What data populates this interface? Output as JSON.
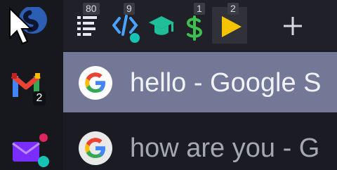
{
  "rail": {
    "apps": [
      {
        "name": "slack-app",
        "badge": ""
      },
      {
        "name": "gmail-app",
        "badge": "2"
      },
      {
        "name": "teams-app",
        "badge": ""
      }
    ]
  },
  "toolbar": {
    "tools": [
      {
        "name": "list-icon",
        "count": "80"
      },
      {
        "name": "code-icon",
        "count": "9"
      },
      {
        "name": "graduation-cap-icon",
        "count": ""
      },
      {
        "name": "dollar-icon",
        "count": "1"
      },
      {
        "name": "play-icon",
        "count": "2"
      }
    ],
    "add_label": "+"
  },
  "tabs": [
    {
      "title": "hello - Google S",
      "active": true,
      "favicon": "google-icon"
    },
    {
      "title": "how are you - G",
      "active": false,
      "favicon": "google-icon"
    }
  ],
  "colors": {
    "background": "#1b1c23",
    "active_tab": "#737897",
    "gmail_red": "#ea4335",
    "code_blue": "#4aa3ff",
    "teal": "#17c3b2",
    "green": "#27ae60",
    "yellow": "#f5c400",
    "purple": "#7b2cff"
  }
}
